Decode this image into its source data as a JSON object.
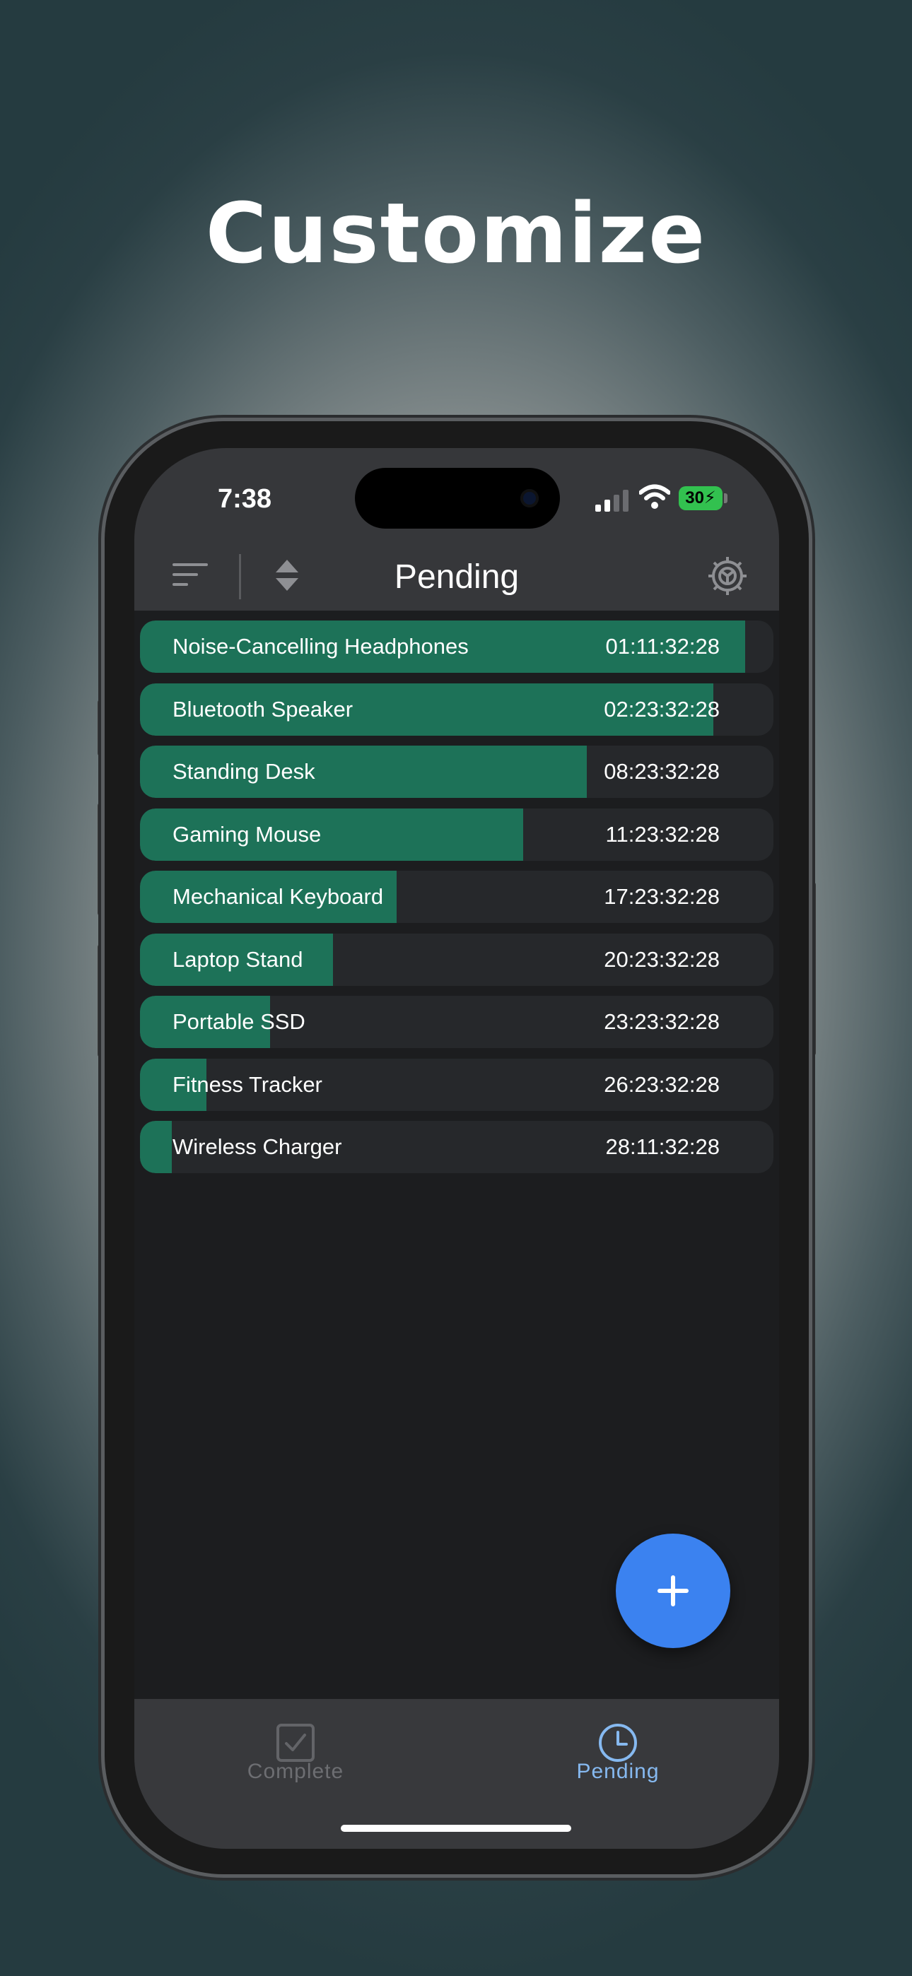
{
  "headline": "Customize",
  "status": {
    "time": "7:38",
    "battery": "30"
  },
  "nav": {
    "title": "Pending"
  },
  "colors": {
    "accent": "#3b82f0",
    "progress_fill": "#1d7258",
    "row_bg": "#26282b"
  },
  "items": [
    {
      "name": "Noise-Cancelling Headphones",
      "time": "01:11:32:28",
      "progress": 0.955
    },
    {
      "name": "Bluetooth Speaker",
      "time": "02:23:32:28",
      "progress": 0.905
    },
    {
      "name": "Standing Desk",
      "time": "08:23:32:28",
      "progress": 0.705
    },
    {
      "name": "Gaming Mouse",
      "time": "11:23:32:28",
      "progress": 0.605
    },
    {
      "name": "Mechanical Keyboard",
      "time": "17:23:32:28",
      "progress": 0.405
    },
    {
      "name": "Laptop Stand",
      "time": "20:23:32:28",
      "progress": 0.305
    },
    {
      "name": "Portable SSD",
      "time": "23:23:32:28",
      "progress": 0.205
    },
    {
      "name": "Fitness Tracker",
      "time": "26:23:32:28",
      "progress": 0.105
    },
    {
      "name": "Wireless Charger",
      "time": "28:11:32:28",
      "progress": 0.05
    }
  ],
  "icons": {
    "sort": "sort-lines-icon",
    "reorder": "up-down-chevron-icon",
    "settings": "gear-icon",
    "add": "plus-icon",
    "complete": "checkbox-icon",
    "pending": "clock-icon"
  },
  "tabs": [
    {
      "label": "Complete",
      "active": false
    },
    {
      "label": "Pending",
      "active": true
    }
  ]
}
